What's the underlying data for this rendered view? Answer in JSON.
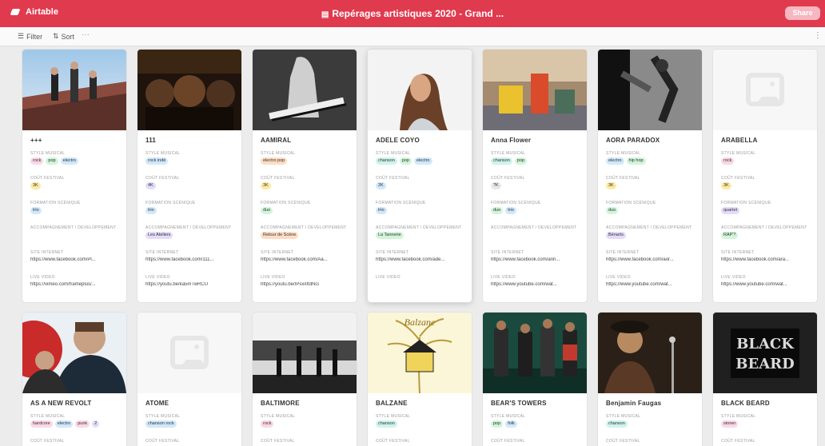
{
  "app": {
    "name": "Airtable",
    "base_title": "Repérages artistiques 2020 - Grand ...",
    "share_label": "Share"
  },
  "toolbar": {
    "filter_label": "Filter",
    "sort_label": "Sort"
  },
  "fields": {
    "style": "STYLE MUSICAL",
    "cost": "COÛT FESTIVAL",
    "format": "FORMATION SCÉNIQUE",
    "accomp": "ACCOMPAGNEMENT / DEVELOPPEMENT",
    "site": "SITE INTERNET",
    "live": "LIVE VIDEO"
  },
  "colors": {
    "brand": "#e03a4e",
    "pink": "#fbd7e6",
    "blue": "#d0e8fb",
    "green": "#d1f5d9",
    "yellow": "#fdeaa3",
    "orange": "#fedcc4",
    "purple": "#e3dbfa",
    "teal": "#cdf3ec",
    "gray": "#e8e8e8"
  },
  "cards": [
    {
      "name": "+++",
      "style_tags": [
        {
          "t": "rock",
          "c": "pink"
        },
        {
          "t": "pop",
          "c": "green"
        },
        {
          "t": "electro",
          "c": "blue"
        }
      ],
      "cost": [
        {
          "t": "3K",
          "c": "yellow"
        }
      ],
      "format": [
        {
          "t": "trio",
          "c": "blue"
        }
      ],
      "accomp": [],
      "site": "https://www.facebook.com/Pl...",
      "live": "https://vimeo.com/frameplus/..."
    },
    {
      "name": "111",
      "style_tags": [
        {
          "t": "rock indé",
          "c": "blue"
        }
      ],
      "cost": [
        {
          "t": "4K",
          "c": "purple"
        }
      ],
      "format": [
        {
          "t": "trio",
          "c": "blue"
        }
      ],
      "accomp": [
        {
          "t": "Les Ateliers",
          "c": "purple"
        }
      ],
      "site": "https://www.facebook.com/111...",
      "live": "https://youtu.be/ka5mTwRCU"
    },
    {
      "name": "AAMIRAL",
      "style_tags": [
        {
          "t": "electro pop",
          "c": "orange"
        }
      ],
      "cost": [
        {
          "t": "3K",
          "c": "yellow"
        }
      ],
      "format": [
        {
          "t": "duo",
          "c": "green"
        }
      ],
      "accomp": [
        {
          "t": "Retour de Scène",
          "c": "orange"
        }
      ],
      "site": "https://www.facebook.com/Aa...",
      "live": "https://youtu.be/IPsxi0tdNG"
    },
    {
      "name": "ADELE COYO",
      "style_tags": [
        {
          "t": "chanson",
          "c": "teal"
        },
        {
          "t": "pop",
          "c": "green"
        },
        {
          "t": "electro",
          "c": "blue"
        }
      ],
      "cost": [
        {
          "t": "2K",
          "c": "blue"
        }
      ],
      "format": [
        {
          "t": "trio",
          "c": "blue"
        }
      ],
      "accomp": [
        {
          "t": "La Tannerie",
          "c": "green"
        }
      ],
      "site": "https://www.facebook.com/ade...",
      "live": ""
    },
    {
      "name": "Anna Flower",
      "style_tags": [
        {
          "t": "chanson",
          "c": "teal"
        },
        {
          "t": "pop",
          "c": "green"
        }
      ],
      "cost": [
        {
          "t": "?K",
          "c": "gray"
        }
      ],
      "format": [
        {
          "t": "duo",
          "c": "green"
        },
        {
          "t": "trio",
          "c": "blue"
        }
      ],
      "accomp": [],
      "site": "https://www.facebook.com/ann...",
      "live": "https://www.youtube.com/wat..."
    },
    {
      "name": "AORA PARADOX",
      "style_tags": [
        {
          "t": "electro",
          "c": "blue"
        },
        {
          "t": "hip hop",
          "c": "green"
        }
      ],
      "cost": [
        {
          "t": "3K",
          "c": "yellow"
        }
      ],
      "format": [
        {
          "t": "duo",
          "c": "green"
        }
      ],
      "accomp": [
        {
          "t": "Bénarts",
          "c": "purple"
        }
      ],
      "site": "https://www.facebook.com/aor...",
      "live": "https://www.youtube.com/wat..."
    },
    {
      "name": "ARABELLA",
      "style_tags": [
        {
          "t": "rock",
          "c": "pink"
        }
      ],
      "cost": [
        {
          "t": "3K",
          "c": "yellow"
        }
      ],
      "format": [
        {
          "t": "quartet",
          "c": "purple"
        }
      ],
      "accomp": [
        {
          "t": "RAP'?",
          "c": "green"
        }
      ],
      "site": "https://www.facebook.com/ara...",
      "live": "https://www.youtube.com/wat..."
    },
    {
      "name": "AS A NEW REVOLT",
      "style_tags": [
        {
          "t": "hardcore",
          "c": "pink"
        },
        {
          "t": "electro",
          "c": "blue"
        },
        {
          "t": "punk",
          "c": "pink"
        },
        {
          "t": "2",
          "c": "purple"
        }
      ],
      "cost": [],
      "format": [],
      "accomp": [],
      "site": "",
      "live": ""
    },
    {
      "name": "ATOME",
      "style_tags": [
        {
          "t": "chanson rock",
          "c": "blue"
        }
      ],
      "cost": [],
      "format": [],
      "accomp": [],
      "site": "",
      "live": ""
    },
    {
      "name": "BALTIMORE",
      "style_tags": [
        {
          "t": "rock",
          "c": "pink"
        }
      ],
      "cost": [],
      "format": [],
      "accomp": [],
      "site": "",
      "live": ""
    },
    {
      "name": "BALZANE",
      "style_tags": [
        {
          "t": "chanson",
          "c": "teal"
        }
      ],
      "cost": [],
      "format": [],
      "accomp": [],
      "site": "",
      "live": ""
    },
    {
      "name": "BEAR'S TOWERS",
      "style_tags": [
        {
          "t": "pop",
          "c": "green"
        },
        {
          "t": "folk",
          "c": "blue"
        }
      ],
      "cost": [],
      "format": [],
      "accomp": [],
      "site": "",
      "live": ""
    },
    {
      "name": "Benjamin Faugas",
      "style_tags": [
        {
          "t": "chanson",
          "c": "teal"
        }
      ],
      "cost": [],
      "format": [],
      "accomp": [],
      "site": "",
      "live": ""
    },
    {
      "name": "BLACK BEARD",
      "style_tags": [
        {
          "t": "stoner",
          "c": "pink"
        }
      ],
      "cost": [],
      "format": [],
      "accomp": [],
      "site": "",
      "live": ""
    }
  ],
  "cover_logo_text": {
    "balzane": "Balzane",
    "blackbeard_1": "BLACK",
    "blackbeard_2": "BEARD"
  }
}
